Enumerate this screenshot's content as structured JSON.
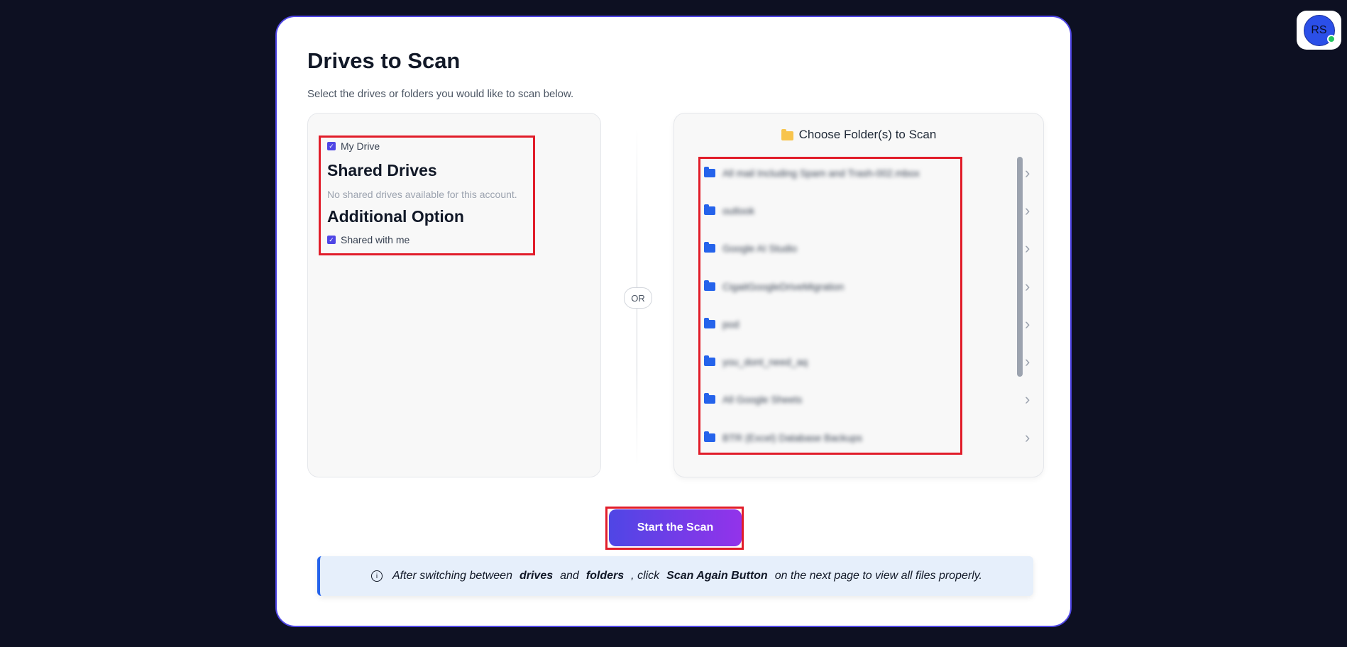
{
  "user": {
    "initials": "RS"
  },
  "page": {
    "title": "Drives to Scan",
    "subtitle": "Select the drives or folders you would like to scan below."
  },
  "drives": {
    "my_drive_label": "My Drive",
    "my_drive_checked": true,
    "shared_drives_heading": "Shared Drives",
    "no_shared_drives": "No shared drives available for this account.",
    "additional_heading": "Additional Option",
    "shared_with_me_label": "Shared with me",
    "shared_with_me_checked": true
  },
  "divider": {
    "label": "OR"
  },
  "folders": {
    "heading": "Choose Folder(s) to Scan",
    "items": [
      {
        "name": "All mail Including Spam and Trash-002.mbox"
      },
      {
        "name": "outlook"
      },
      {
        "name": "Google AI Studio"
      },
      {
        "name": "CigaitGoogleDriveMigration"
      },
      {
        "name": "pod"
      },
      {
        "name": "you_dont_need_aq"
      },
      {
        "name": "All Google Sheets"
      },
      {
        "name": "BTR (Excel) Database Backups"
      }
    ]
  },
  "actions": {
    "start_label": "Start the Scan"
  },
  "info": {
    "text_1": "After switching between",
    "bold_1": "drives",
    "text_2": "and",
    "bold_2": "folders",
    "text_3": ", click",
    "bold_3": "Scan Again Button",
    "text_4": "on the next page to view all files properly."
  },
  "colors": {
    "accent": "#4f46e5",
    "highlight": "#e11d2a",
    "folder": "#2563eb",
    "background": "#0d1022"
  }
}
